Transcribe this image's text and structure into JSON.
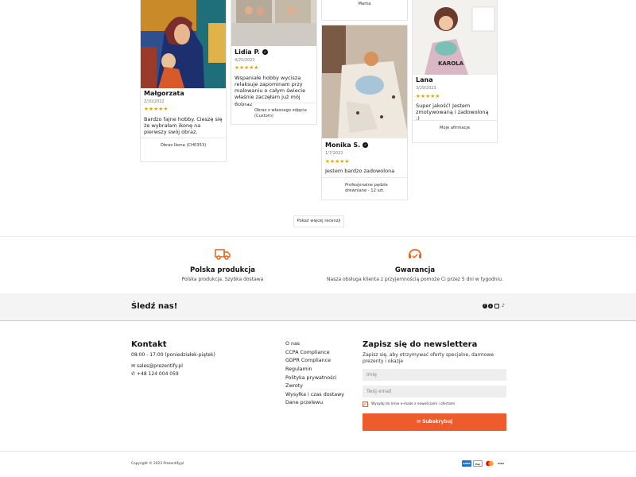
{
  "reviews": [
    {
      "name": "Małgorzata",
      "verified": false,
      "date": "2/10/2022",
      "stars": "★★★★★",
      "text": "Bardzo fajne hobby. Cieszę się że wybrałam ikonę na pierwszy swój obraz.",
      "product": "Obraz Ikona (CH0353)"
    },
    {
      "name": "Lidia P.",
      "verified": true,
      "date": "4/25/2022",
      "stars": "★★★★★",
      "text": "Wspaniałe hobby wycisza relaksuje zapominam przy malowaniu o całym świecie właśnie zaczęłam już mój 6obraz",
      "product": "Obraz z własnego zdjęcia (Custom)"
    },
    {
      "partial_text": "Mama"
    },
    {
      "name": "Monika S.",
      "verified": true,
      "date": "1/7/2022",
      "stars": "★★★★★",
      "text": "Jestem bardzo zadowolona",
      "product": "Profesjonalne pędzle drewniane - 12 szt."
    },
    {
      "name": "Lana",
      "verified": false,
      "date": "3/29/2023",
      "stars": "★★★★★",
      "text": "Super jakość! Jestem zmotywowaną i zadowoloną :)",
      "product": "Moje afirmacje",
      "photo_caption": "KAROLA"
    }
  ],
  "more_reviews_label": "Pokaż więcej recenzji",
  "features": [
    {
      "icon": "truck-icon",
      "title": "Polska produkcja",
      "text": "Polska produkcja. Szybka dostawa"
    },
    {
      "icon": "support-headset-icon",
      "title": "Gwarancja",
      "text": "Nasza obsługa klienta z przyjemnością pomoże Ci przez 5 dni w tygodniu."
    }
  ],
  "follow": {
    "title": "Śledź nas!",
    "networks": [
      "facebook-icon",
      "pinterest-icon",
      "instagram-icon",
      "tiktok-icon"
    ]
  },
  "contact": {
    "title": "Kontakt",
    "hours": "08:00 - 17:00 (poniedziałek-piątek)",
    "email": "sales@prezentify.pl",
    "phone": "+48 124 004 059"
  },
  "footer_links": [
    "O nas",
    "CCPA Compliance",
    "GDPR Compliance",
    "Regulamin",
    "Polityka prywatności",
    "Zwroty",
    "Wysyłka i czas dostawy",
    "Dane przelewu"
  ],
  "newsletter": {
    "title": "Zapisz się do newslettera",
    "text": "Zapisz się, aby otrzymywać oferty specjalne, darmowe prezenty i okazje",
    "name_placeholder": "Imię",
    "email_placeholder": "Twój email",
    "consent": "Wysyłaj do mnie e-maile z nowościami i ofertami",
    "button": "Subskrybuj",
    "accent": "#ee5b2c"
  },
  "copyright": "Copyright © 2023 Prezentify.pl",
  "payments": [
    "AMEX",
    "Pay",
    "MC",
    "VISA"
  ]
}
